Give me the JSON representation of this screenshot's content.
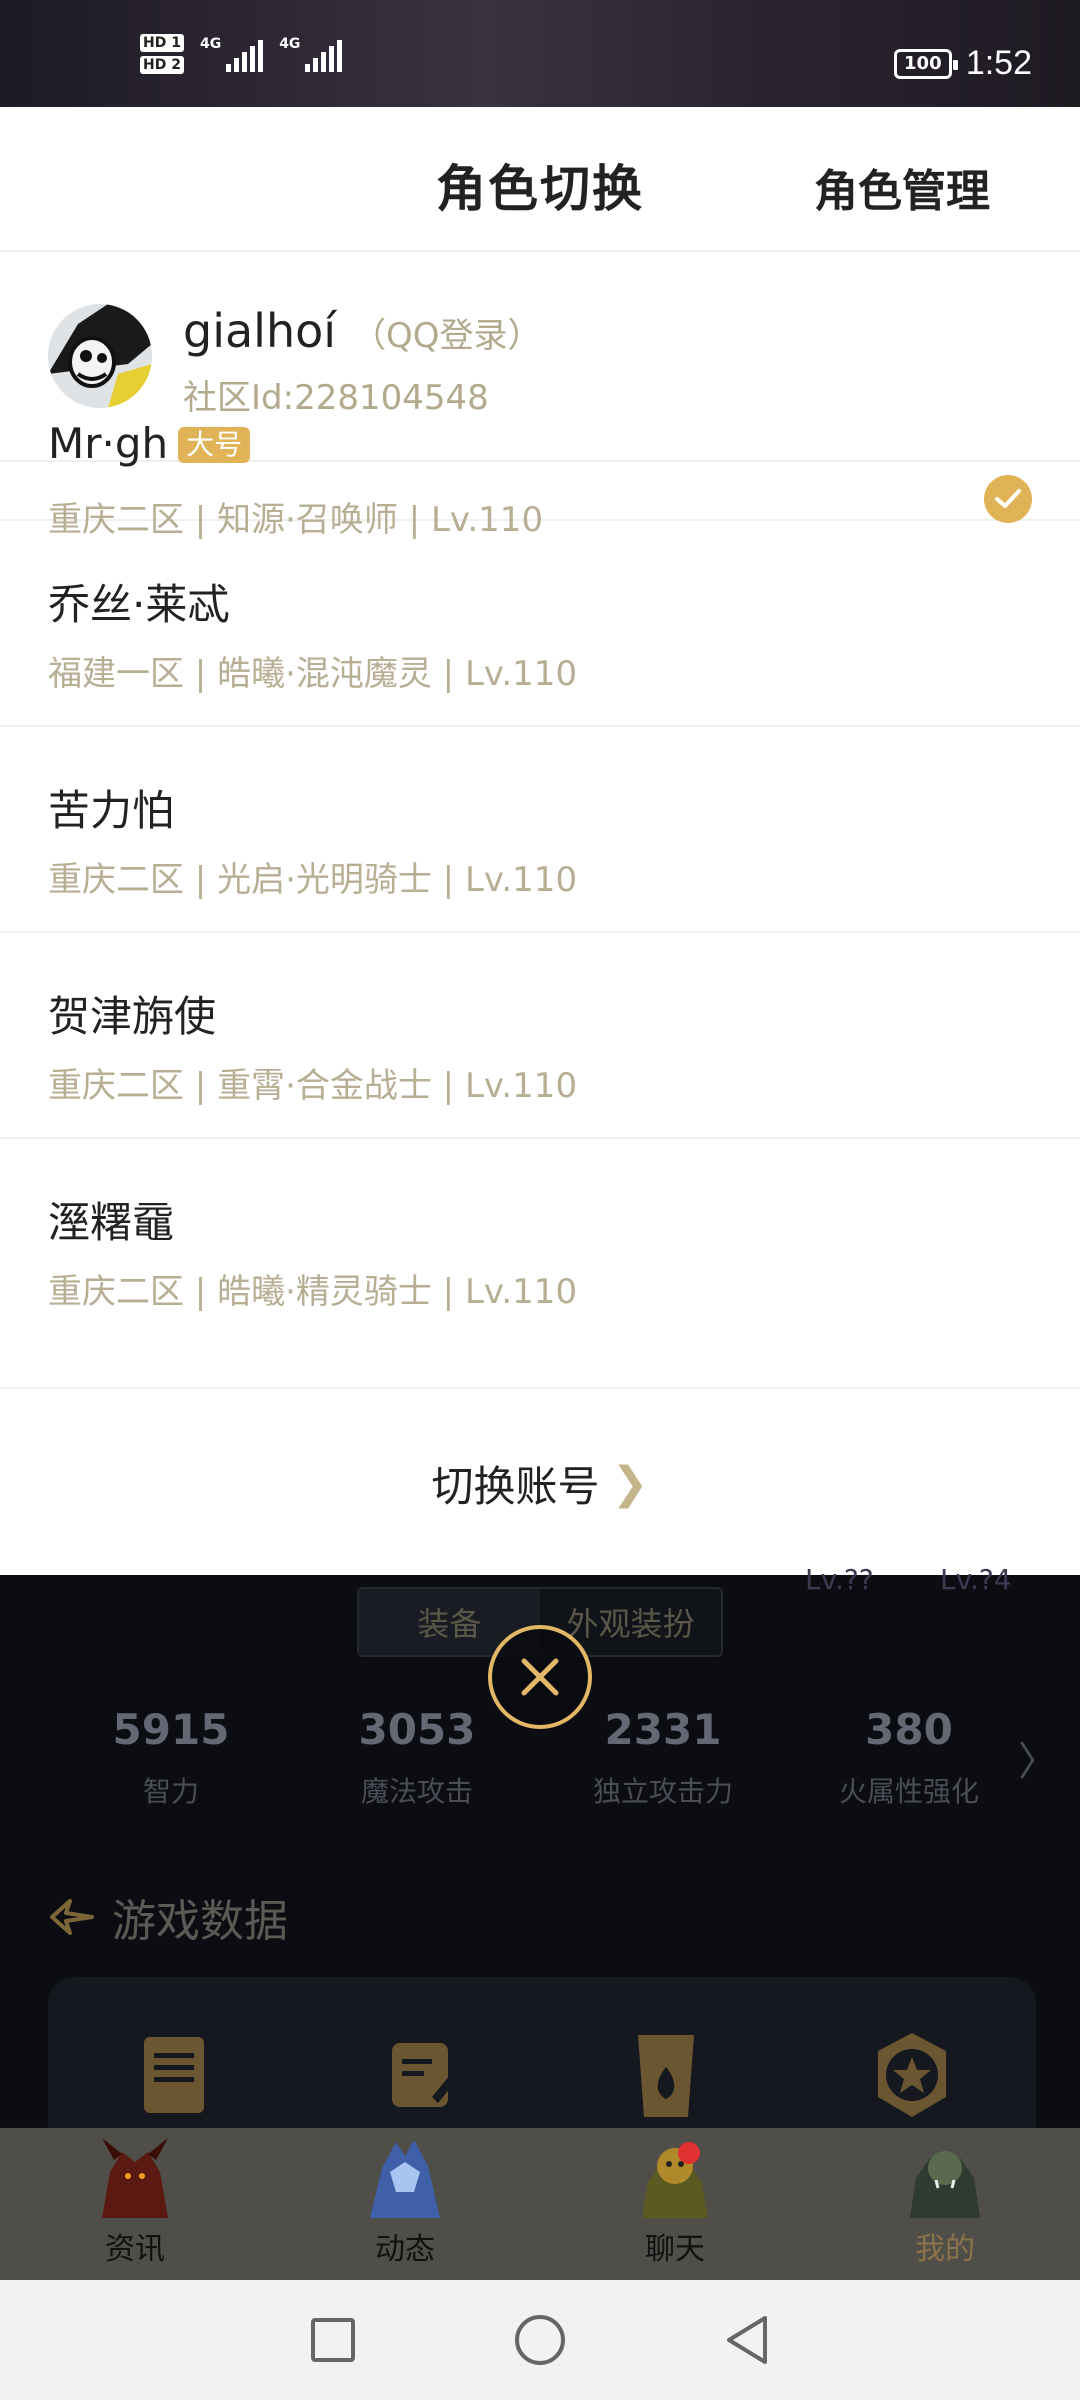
{
  "status_bar": {
    "hd1": "HD 1",
    "hd2": "HD 2",
    "net1": "4G",
    "net2": "4G",
    "battery": "100",
    "time": "1:52"
  },
  "sheet": {
    "title": "角色切换",
    "manage_label": "角色管理",
    "account": {
      "name": "gialhoí",
      "login_type": "（QQ登录）",
      "community_id": "社区Id:228104548"
    },
    "roles": [
      {
        "name": "Mr·gh",
        "badge": "大号",
        "info": "重庆二区 | 知源·召唤师 | Lv.110",
        "selected": true
      },
      {
        "name": "乔丝·莱忒",
        "info": "福建一区 | 皓曦·混沌魔灵 | Lv.110",
        "selected": false
      },
      {
        "name": "苦力怕",
        "info": "重庆二区 | 光启·光明骑士 | Lv.110",
        "selected": false
      },
      {
        "name": "贺津旃使",
        "info": "重庆二区 | 重霄·合金战士 | Lv.110",
        "selected": false
      },
      {
        "name": "溼糬黿",
        "info": "重庆二区 | 皓曦·精灵骑士 | Lv.110",
        "selected": false
      }
    ],
    "switch_account_label": "切换账号"
  },
  "background": {
    "lv_left": "Lv.??",
    "lv_right": "Lv.?4",
    "tabs": [
      "装备",
      "外观装扮"
    ],
    "stats": [
      {
        "value": "5915",
        "label": "智力"
      },
      {
        "value": "3053",
        "label": "魔法攻击"
      },
      {
        "value": "2331",
        "label": "独立攻击力"
      },
      {
        "value": "380",
        "label": "火属性强化"
      }
    ],
    "section_title": "游戏数据"
  },
  "bottom_nav": {
    "items": [
      {
        "label": "资讯"
      },
      {
        "label": "动态"
      },
      {
        "label": "聊天"
      },
      {
        "label": "我的"
      }
    ]
  },
  "colors": {
    "accent_gold": "#e0b456",
    "secondary_text": "#b8ae94",
    "nav_bg": "#504e48"
  }
}
